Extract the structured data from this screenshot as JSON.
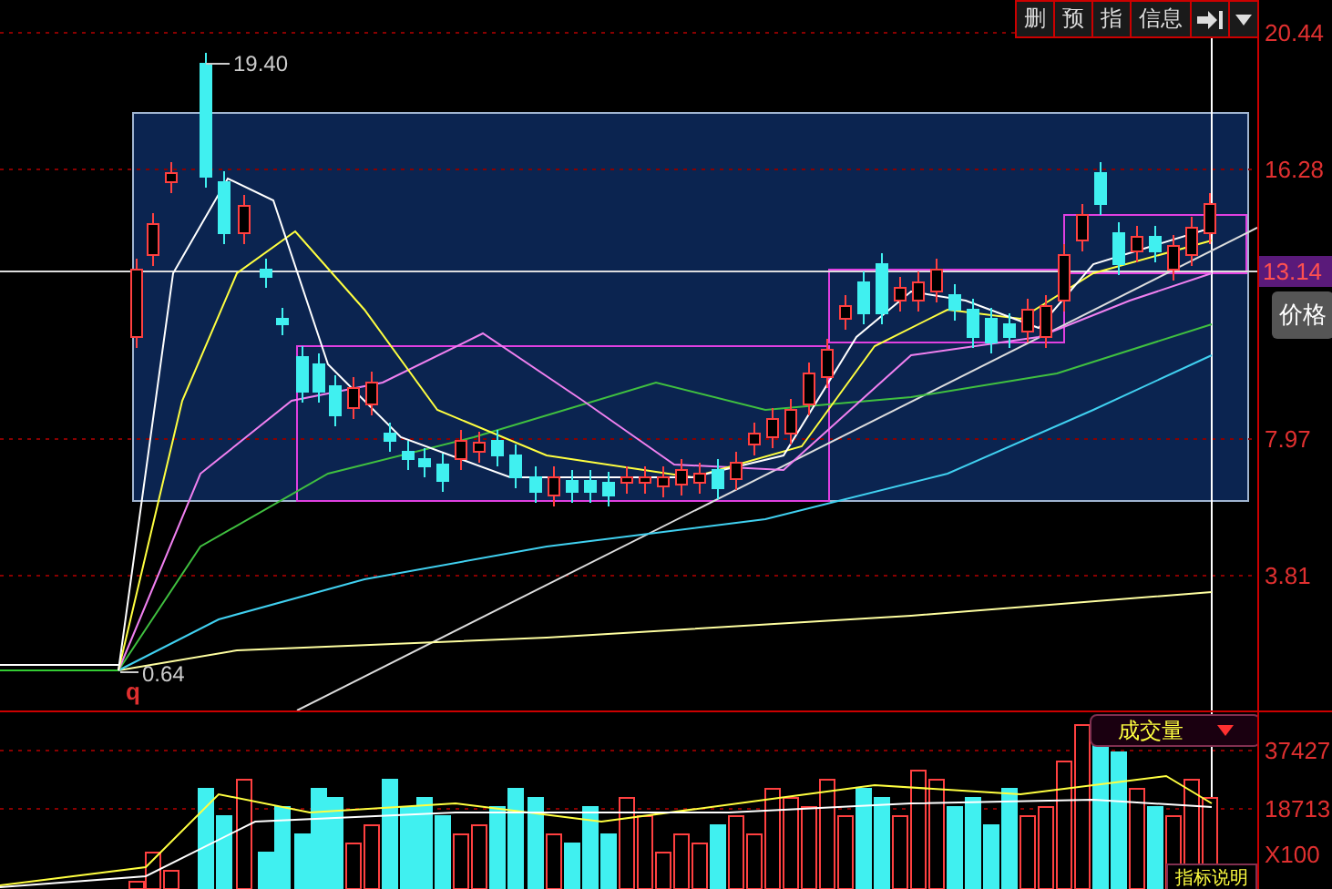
{
  "toolbar": {
    "buttons": [
      "删",
      "预",
      "指",
      "信息"
    ]
  },
  "price_axis": {
    "ticks": [
      "20.44",
      "16.28",
      "7.97",
      "3.81"
    ],
    "crosshair_value": "13.14"
  },
  "price_button": "价格",
  "annotations": {
    "high": "19.40",
    "low": "0.64",
    "marker": "q"
  },
  "volume": {
    "indicator": "成交量",
    "ticks": [
      "37427",
      "18713"
    ],
    "unit": "X100",
    "explain": "指标说明"
  }
}
